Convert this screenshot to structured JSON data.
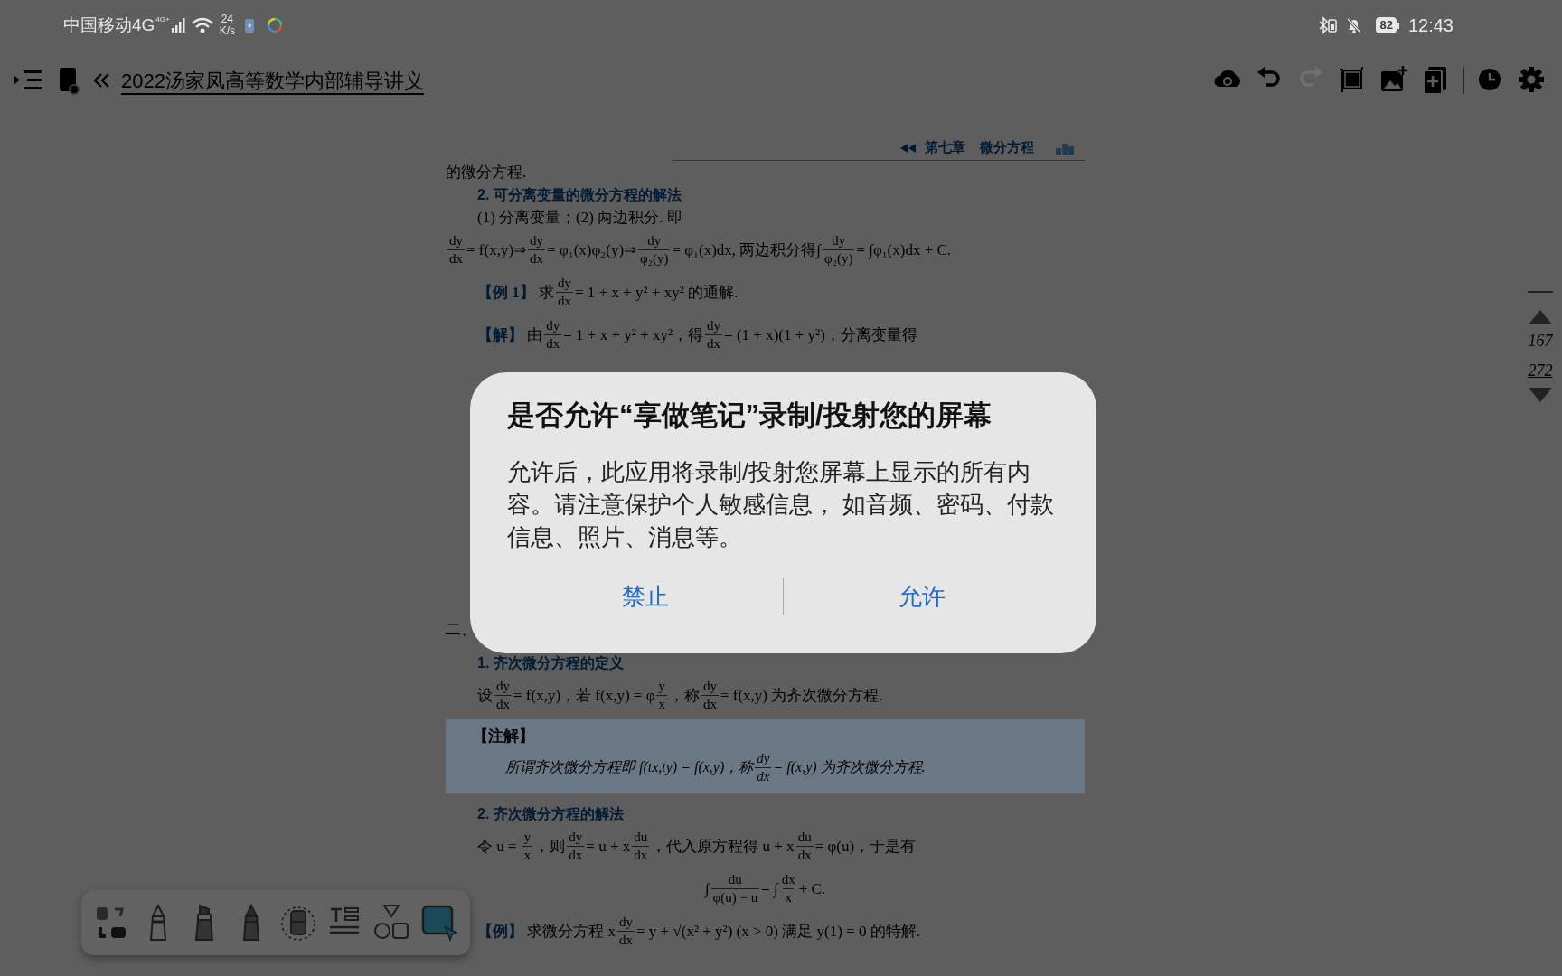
{
  "status_bar": {
    "carrier": "中国移动4G",
    "network": "4G+",
    "speed": "24",
    "speed_unit": "K/s",
    "battery": "82",
    "time": "12:43"
  },
  "toolbar": {
    "title": "2022汤家凤高等数学内部辅导讲义",
    "icons": [
      {
        "kind": "cloud",
        "disabled": false
      },
      {
        "kind": "undo",
        "disabled": false
      },
      {
        "kind": "redo",
        "disabled": true
      },
      {
        "kind": "crop",
        "disabled": false
      },
      {
        "kind": "add-image",
        "disabled": false
      },
      {
        "kind": "add-page",
        "disabled": false
      },
      {
        "kind": "clock",
        "disabled": false
      },
      {
        "kind": "settings",
        "disabled": false
      }
    ]
  },
  "document": {
    "header": {
      "chapter": "第七章",
      "title": "微分方程"
    },
    "top_blocks": [
      {
        "kind": "text",
        "parts": [
          "的微分方程."
        ]
      },
      {
        "kind": "heading",
        "parts": [
          "2. 可分离变量的微分方程的解法"
        ]
      },
      {
        "kind": "text",
        "indent": true,
        "parts": [
          "(1) 分离变量；(2) 两边积分. 即"
        ]
      },
      {
        "kind": "formula",
        "parts": [
          {
            "num": "dy",
            "den": "dx"
          },
          "= f(x,y)⇒",
          {
            "num": "dy",
            "den": "dx"
          },
          "= φ₁(x)φ₂(y)⇒",
          {
            "num": "dy",
            "den": "φ₂(y)"
          },
          "= φ₁(x)dx, 两边积分得∫",
          {
            "num": "dy",
            "den": "φ₂(y)"
          },
          "= ∫φ₁(x)dx + C."
        ]
      },
      {
        "kind": "formula",
        "indent": true,
        "parts": [
          {
            "label": "【例 1】"
          },
          " 求",
          {
            "num": "dy",
            "den": "dx"
          },
          "= 1 + x + y² + xy² 的通解."
        ]
      },
      {
        "kind": "formula",
        "indent": true,
        "parts": [
          {
            "label": "【解】"
          },
          " 由",
          {
            "num": "dy",
            "den": "dx"
          },
          "= 1 + x + y² + xy²，得",
          {
            "num": "dy",
            "den": "dx"
          },
          "= (1 + x)(1 + y²)，分离变量得"
        ]
      }
    ],
    "bottom_blocks": [
      {
        "kind": "text",
        "parts": [
          "二、"
        ]
      },
      {
        "kind": "heading",
        "parts": [
          "1. 齐次微分方程的定义"
        ]
      },
      {
        "kind": "formula",
        "indent": true,
        "parts": [
          "设",
          {
            "num": "dy",
            "den": "dx"
          },
          "= f(x,y)，若 f(x,y) = φ",
          {
            "num": "y",
            "den": "x"
          },
          "，称",
          {
            "num": "dy",
            "den": "dx"
          },
          "= f(x,y) 为齐次微分方程."
        ]
      },
      {
        "kind": "note",
        "label": "【注解】",
        "parts": [
          "所谓齐次微分方程即 f(tx,ty) = f(x,y)，称",
          {
            "num": "dy",
            "den": "dx"
          },
          "= f(x,y) 为齐次微分方程."
        ]
      },
      {
        "kind": "heading",
        "parts": [
          "2. 齐次微分方程的解法"
        ]
      },
      {
        "kind": "formula",
        "indent": true,
        "parts": [
          "令 u = ",
          {
            "num": "y",
            "den": "x"
          },
          "，则",
          {
            "num": "dy",
            "den": "dx"
          },
          "= u + x",
          {
            "num": "du",
            "den": "dx"
          },
          "，代入原方程得 u + x",
          {
            "num": "du",
            "den": "dx"
          },
          "= φ(u)，于是有"
        ]
      },
      {
        "kind": "centered",
        "parts": [
          "∫",
          {
            "num": "du",
            "den": "φ(u) − u"
          },
          "= ∫",
          {
            "num": "dx",
            "den": "x"
          },
          "+ C."
        ]
      },
      {
        "kind": "formula",
        "indent": true,
        "parts": [
          {
            "label": "【例】"
          },
          " 求微分方程 x",
          {
            "num": "dy",
            "den": "dx"
          },
          "= y + √(x² + y²) (x > 0) 满足 y(1) = 0 的特解."
        ]
      }
    ]
  },
  "page_nav": {
    "current": "167",
    "total": "272"
  },
  "tools": [
    {
      "kind": "lasso",
      "selected": false
    },
    {
      "kind": "fountain-pen",
      "selected": false
    },
    {
      "kind": "marker",
      "selected": false
    },
    {
      "kind": "pencil",
      "selected": false
    },
    {
      "kind": "eraser",
      "selected": false
    },
    {
      "kind": "text",
      "selected": false
    },
    {
      "kind": "shapes",
      "selected": false
    },
    {
      "kind": "select",
      "selected": true
    }
  ],
  "dialog": {
    "title": "是否允许“享做笔记”录制/投射您的屏幕",
    "message": "允许后，此应用将录制/投射您屏幕上显示的所有内容。请注意保护个人敏感信息， 如音频、密码、付款信息、照片、消息等。",
    "buttons": [
      {
        "label": "禁止"
      },
      {
        "label": "允许"
      }
    ]
  }
}
